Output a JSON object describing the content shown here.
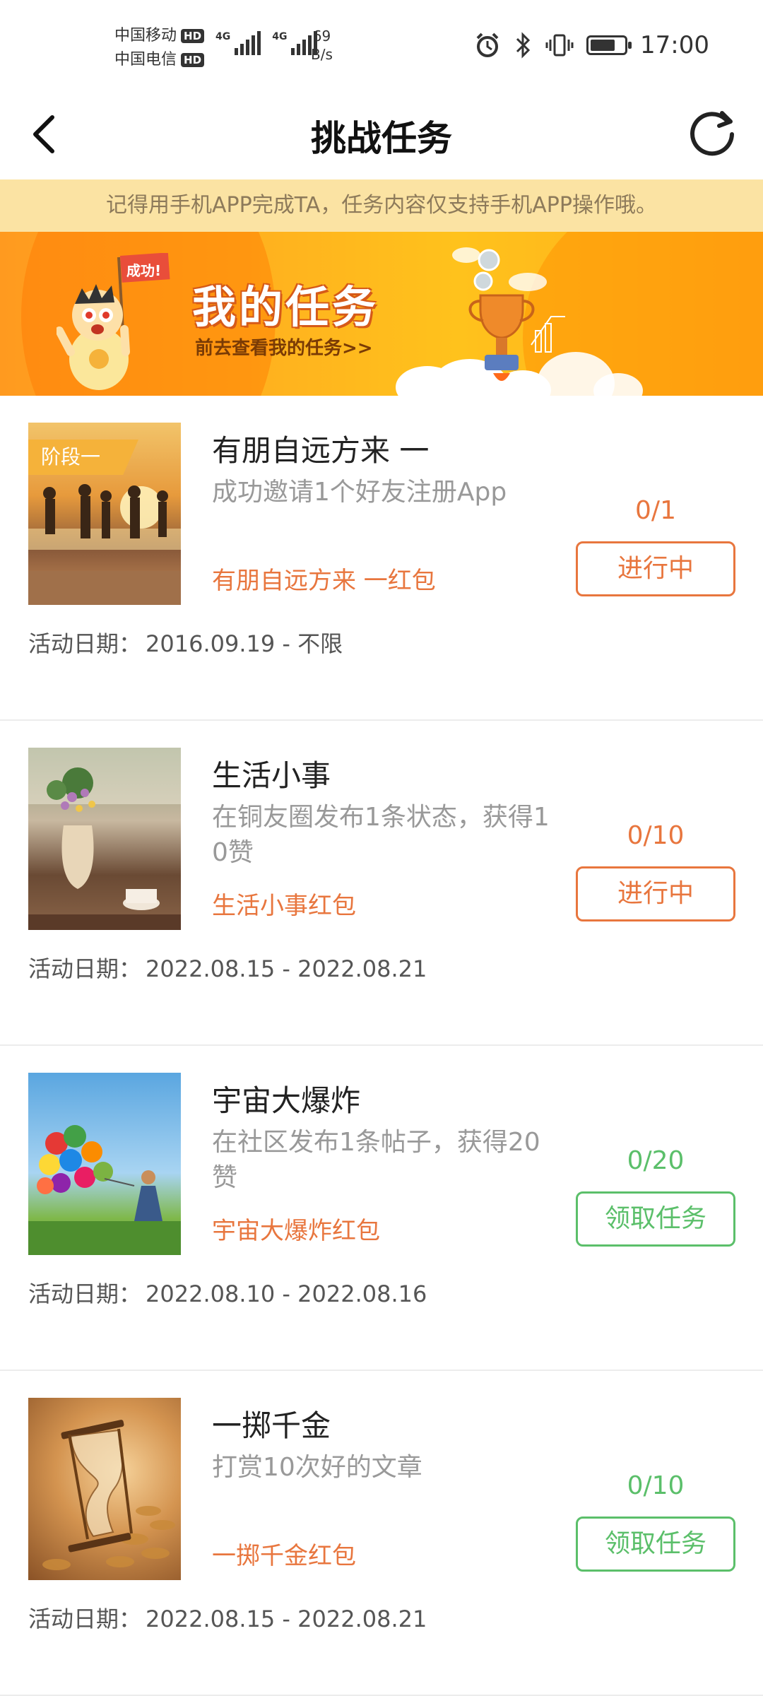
{
  "status_bar": {
    "carrier1": "中国移动",
    "carrier2": "中国电信",
    "hd": "HD",
    "net": "4G",
    "speed_value": "69",
    "speed_unit": "B/s",
    "time": "17:00"
  },
  "header": {
    "title": "挑战任务"
  },
  "notice": "记得用手机APP完成TA，任务内容仅支持手机APP操作哦。",
  "banner": {
    "badge": "成功!",
    "title": "我的任务",
    "link": "前去查看我的任务>>"
  },
  "date_label": "活动日期：",
  "tasks": [
    {
      "stage": "阶段一",
      "name": "有朋自远方来 一",
      "desc": "成功邀请1个好友注册App",
      "reward": "有朋自远方来 一红包",
      "progress": "0/1",
      "button": "进行中",
      "date": "2016.09.19 - 不限",
      "status": "in_progress"
    },
    {
      "stage": "",
      "name": "生活小事",
      "desc": "在铜友圈发布1条状态，获得10赞",
      "reward": "生活小事红包",
      "progress": "0/10",
      "button": "进行中",
      "date": "2022.08.15 - 2022.08.21",
      "status": "in_progress"
    },
    {
      "stage": "",
      "name": "宇宙大爆炸",
      "desc": "在社区发布1条帖子，获得20赞",
      "reward": "宇宙大爆炸红包",
      "progress": "0/20",
      "button": "领取任务",
      "date": "2022.08.10 - 2022.08.16",
      "status": "available"
    },
    {
      "stage": "",
      "name": "一掷千金",
      "desc": "打赏10次好的文章",
      "reward": "一掷千金红包",
      "progress": "0/10",
      "button": "领取任务",
      "date": "2022.08.15 - 2022.08.21",
      "status": "available"
    }
  ],
  "colors": {
    "accent_orange": "#e8763e",
    "accent_green": "#5bbf6a",
    "notice_bg": "#fbe3a3",
    "banner_bg": "#ffb21e"
  }
}
